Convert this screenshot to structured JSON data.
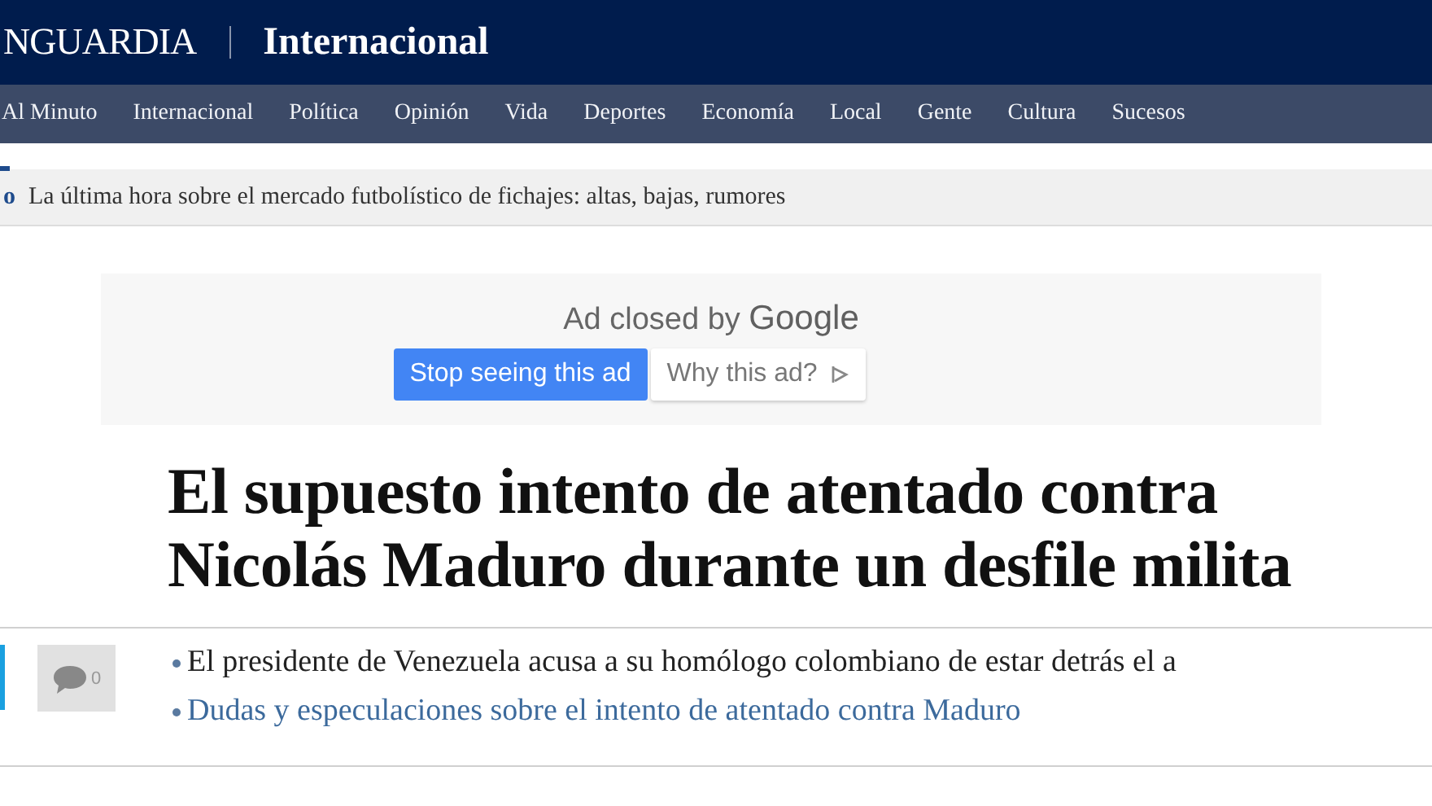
{
  "masthead": {
    "brand": "NGUARDIA",
    "section": "Internacional"
  },
  "nav": {
    "items": [
      {
        "label": "Al Minuto"
      },
      {
        "label": "Internacional"
      },
      {
        "label": "Política"
      },
      {
        "label": "Opinión"
      },
      {
        "label": "Vida"
      },
      {
        "label": "Deportes"
      },
      {
        "label": "Economía"
      },
      {
        "label": "Local"
      },
      {
        "label": "Gente"
      },
      {
        "label": "Cultura"
      },
      {
        "label": "Sucesos"
      }
    ]
  },
  "ticker": {
    "tag": "o",
    "text": "La última hora sobre el mercado futbolístico de fichajes: altas, bajas, rumores"
  },
  "ad": {
    "message": "Ad closed by",
    "provider": "Google",
    "buttons": [
      {
        "label": "Stop seeing this ad",
        "kind": "primary"
      },
      {
        "label": "Why this ad?",
        "kind": "secondary"
      }
    ]
  },
  "headline": {
    "lines": [
      "El supuesto intento de atentado contra",
      "Nicolás Maduro durante un desfile milita"
    ]
  },
  "comments": {
    "count": "0"
  },
  "related": [
    {
      "text": "El presidente de Venezuela acusa a su homólogo colombiano de estar detrás el a",
      "kind": "text"
    },
    {
      "text": "Dudas y especulaciones sobre el intento de atentado contra Maduro",
      "kind": "link"
    }
  ]
}
